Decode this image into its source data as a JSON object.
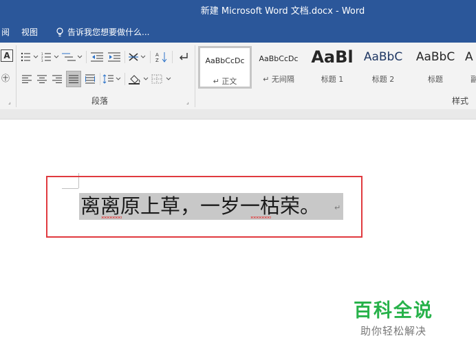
{
  "window": {
    "title": "新建 Microsoft Word 文档.docx - Word"
  },
  "menubar": {
    "partial_tab": "阅",
    "view_tab": "视图",
    "tell_me": "告诉我您想要做什么..."
  },
  "ribbon": {
    "font_partial_letter": "A",
    "font_partial_icon": "㊉",
    "paragraph_group_label": "段落",
    "styles_group_label": "样式",
    "styles": [
      {
        "preview": "AaBbCcDc",
        "caption": "↵ 正文",
        "selected": true
      },
      {
        "preview": "AaBbCcDc",
        "caption": "↵ 无间隔",
        "selected": false
      },
      {
        "preview": "AaBl",
        "caption": "标题 1",
        "selected": false
      },
      {
        "preview": "AaBbC",
        "caption": "标题 2",
        "selected": false
      },
      {
        "preview": "AaBbC",
        "caption": "标题",
        "selected": false
      },
      {
        "preview": "A",
        "caption": "副",
        "selected": false
      }
    ]
  },
  "document": {
    "text": "离离原上草，一岁一枯荣。",
    "paragraph_mark": "↵"
  },
  "watermark": {
    "title": "百科全说",
    "subtitle": "助你轻松解决"
  },
  "colors": {
    "title_bar": "#2b579a",
    "highlight_box": "#e0393e",
    "selection": "#c8c8c8",
    "watermark_green": "#27b24a"
  }
}
